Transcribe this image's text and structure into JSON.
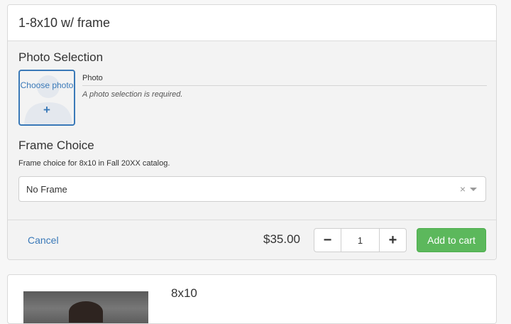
{
  "product": {
    "title": "1-8x10 w/ frame"
  },
  "photo_selection": {
    "heading": "Photo Selection",
    "choose_label": "Choose photo",
    "plus_glyph": "+",
    "field_label": "Photo",
    "help_text": "A photo selection is required."
  },
  "frame_choice": {
    "heading": "Frame Choice",
    "description": "Frame choice for 8x10 in Fall 20XX catalog.",
    "selected": "No Frame",
    "clear_glyph": "×"
  },
  "footer": {
    "cancel_label": "Cancel",
    "price": "$35.00",
    "quantity": "1",
    "minus_glyph": "−",
    "plus_glyph": "+",
    "add_to_cart_label": "Add to cart"
  },
  "next_item": {
    "title": "8x10"
  },
  "colors": {
    "link": "#3a79b8",
    "success": "#5cb85c",
    "panel_bg": "#f3f3f3"
  },
  "icons": {
    "photo_placeholder": "person-silhouette-icon",
    "clear": "close-icon",
    "dropdown": "caret-down-icon"
  }
}
